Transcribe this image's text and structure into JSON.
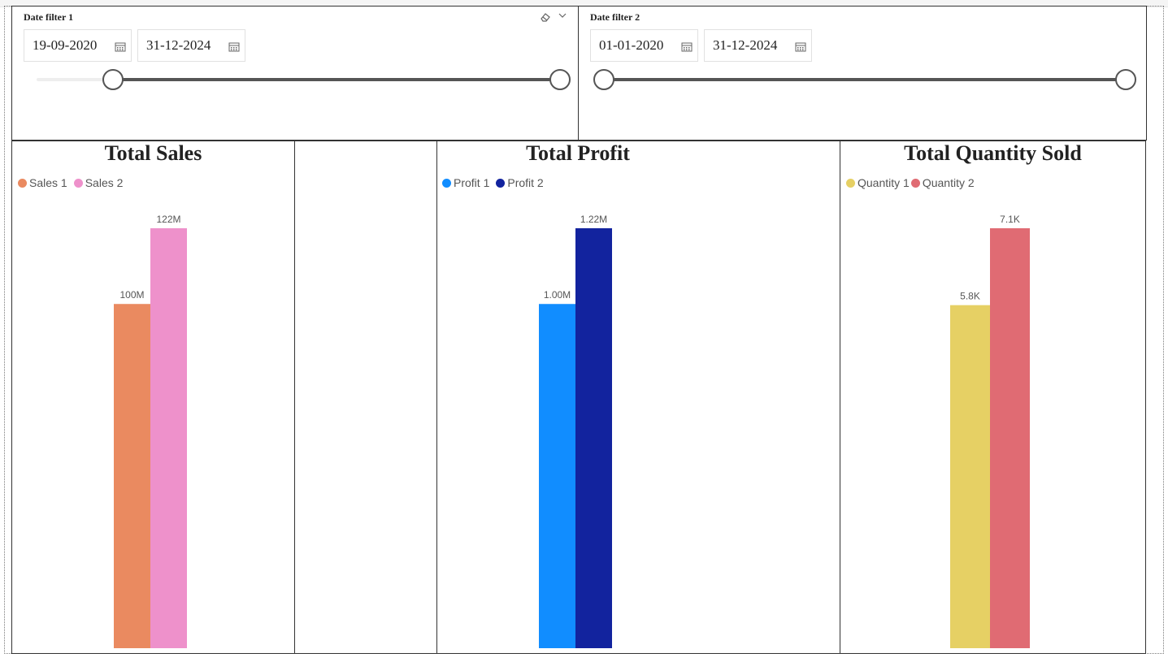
{
  "slicers": [
    {
      "title": "Date filter 1",
      "start_date": "19-09-2020",
      "end_date": "31-12-2024",
      "range_start_fraction": 0.14,
      "range_end_fraction": 1.0,
      "icons": [
        "eraser-icon",
        "chevron-down-icon"
      ]
    },
    {
      "title": "Date filter 2",
      "start_date": "01-01-2020",
      "end_date": "31-12-2024",
      "range_start_fraction": 0.0,
      "range_end_fraction": 1.0
    }
  ],
  "colors": {
    "sales1": "#EA8A60",
    "sales2": "#EE91CB",
    "profit1": "#118DFF",
    "profit2": "#12239E",
    "quantity1": "#E6D064",
    "quantity2": "#E06B73"
  },
  "chart_data": [
    {
      "type": "bar",
      "title": "Total Sales",
      "series": [
        {
          "name": "Sales 1",
          "values": [
            100000000
          ],
          "label": "100M",
          "color": "#EA8A60"
        },
        {
          "name": "Sales 2",
          "values": [
            122000000
          ],
          "label": "122M",
          "color": "#EE91CB"
        }
      ],
      "ylim": [
        0,
        122000000
      ]
    },
    {
      "type": "bar",
      "title": "Total Profit",
      "series": [
        {
          "name": "Profit 1",
          "values": [
            1000000
          ],
          "label": "1.00M",
          "color": "#118DFF"
        },
        {
          "name": "Profit 2",
          "values": [
            1220000
          ],
          "label": "1.22M",
          "color": "#12239E"
        }
      ],
      "ylim": [
        0,
        1220000
      ]
    },
    {
      "type": "bar",
      "title": "Total Quantity Sold",
      "series": [
        {
          "name": "Quantity 1",
          "values": [
            5800
          ],
          "label": "5.8K",
          "color": "#E6D064"
        },
        {
          "name": "Quantity 2",
          "values": [
            7100
          ],
          "label": "7.1K",
          "color": "#E06B73"
        }
      ],
      "ylim": [
        0,
        7100
      ]
    }
  ]
}
